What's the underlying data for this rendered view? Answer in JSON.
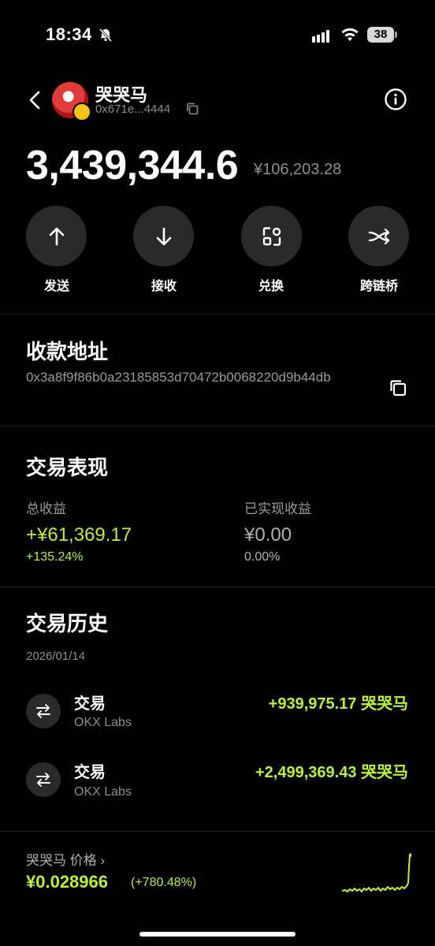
{
  "status_bar": {
    "time": "18:34",
    "battery": "38"
  },
  "header": {
    "token_name": "哭哭马",
    "token_address": "0x671e...4444"
  },
  "balance": {
    "amount": "3,439,344.6",
    "fiat": "¥106,203.28"
  },
  "actions": [
    {
      "label": "发送",
      "icon": "arrow-up-icon"
    },
    {
      "label": "接收",
      "icon": "arrow-down-icon"
    },
    {
      "label": "兑换",
      "icon": "swap-icon"
    },
    {
      "label": "跨链桥",
      "icon": "bridge-icon"
    }
  ],
  "receive": {
    "title": "收款地址",
    "address": "0x3a8f9f86b0a23185853d70472b0068220d9b44db"
  },
  "performance": {
    "title": "交易表现",
    "total_label": "总收益",
    "total_value": "+¥61,369.17",
    "total_pct": "+135.24%",
    "realized_label": "已实现收益",
    "realized_value": "¥0.00",
    "realized_pct": "0.00%"
  },
  "history": {
    "title": "交易历史",
    "date": "2026/01/14",
    "items": [
      {
        "title": "交易",
        "source": "OKX Labs",
        "amount": "+939,975.17 哭哭马"
      },
      {
        "title": "交易",
        "source": "OKX Labs",
        "amount": "+2,499,369.43 哭哭马"
      }
    ]
  },
  "price": {
    "label": "哭哭马 价格 ›",
    "value": "¥0.028966",
    "change": "(+780.48%)"
  },
  "colors": {
    "accent_green": "#b8f23a",
    "button_bg": "#2a2a2a"
  }
}
